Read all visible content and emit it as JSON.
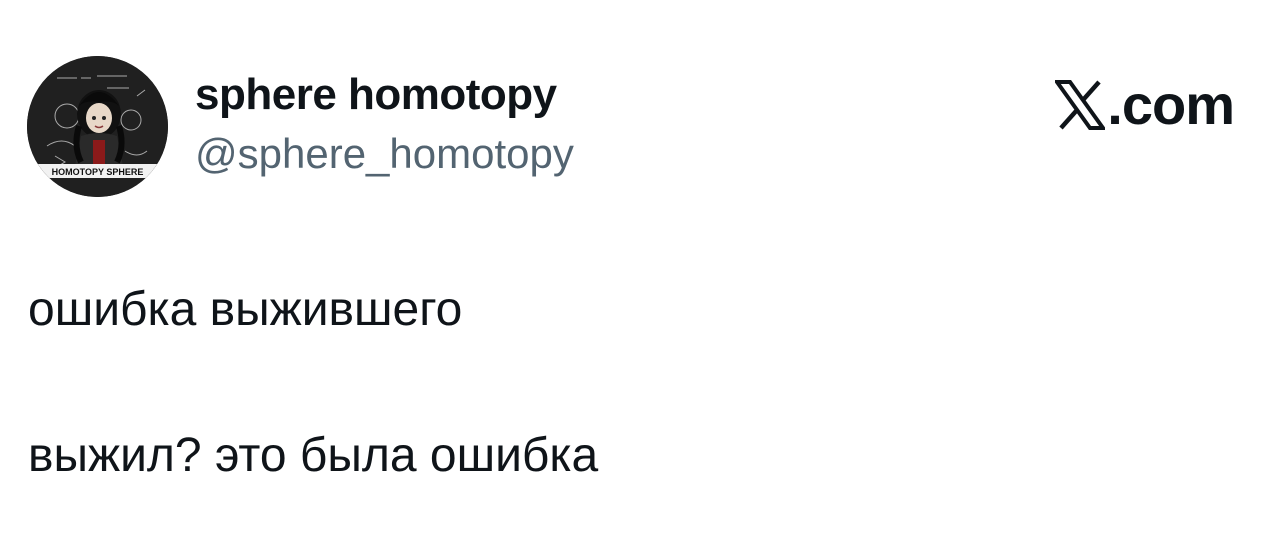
{
  "author": {
    "display_name": "sphere homotopy",
    "handle": "@sphere_homotopy",
    "avatar_caption": "HOMOTOPY SPHERE"
  },
  "brand": {
    "text": ".com",
    "icon": "x-logo-icon"
  },
  "tweet": {
    "lines": [
      "ошибка выжившего",
      "выжил? это была ошибка"
    ]
  },
  "colors": {
    "text_primary": "#0f1419",
    "text_secondary": "#536471",
    "background": "#ffffff"
  }
}
